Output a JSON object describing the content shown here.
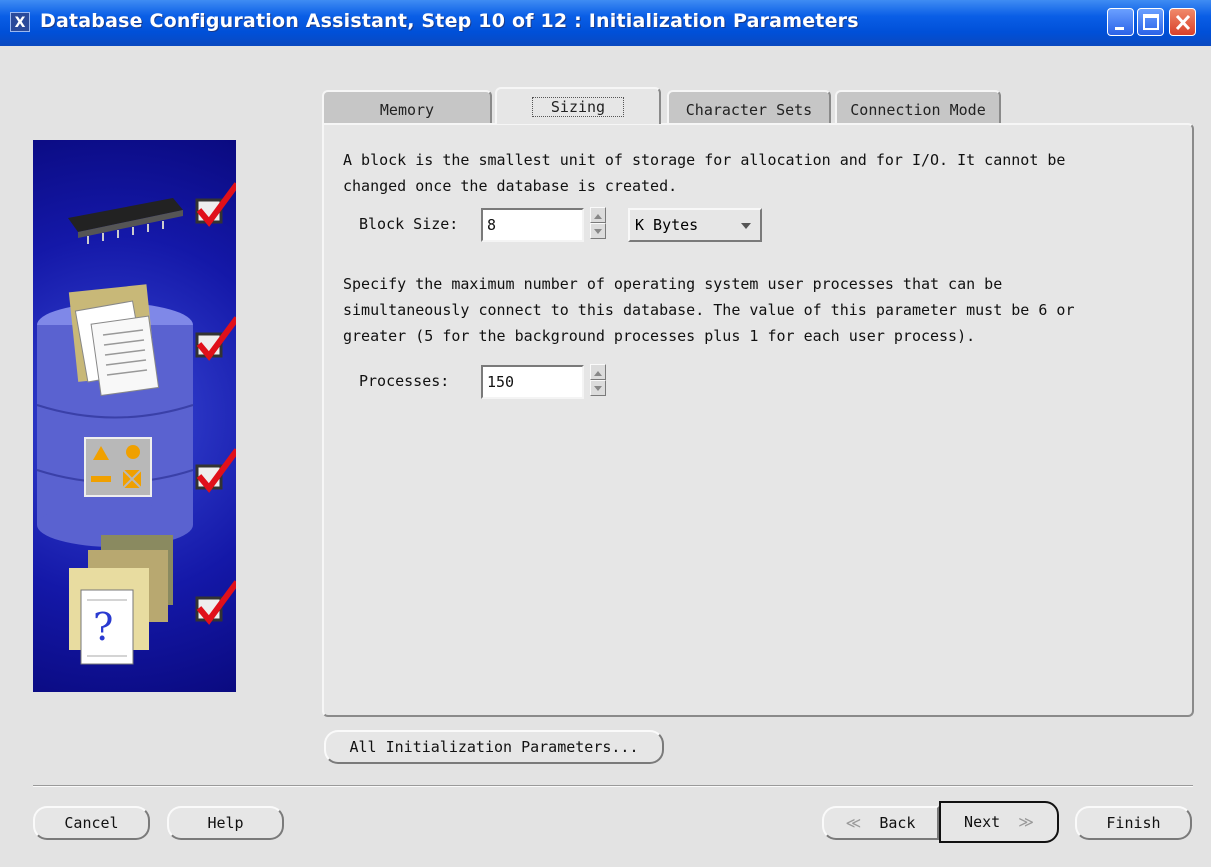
{
  "window": {
    "title": "Database Configuration Assistant, Step 10 of 12 : Initialization Parameters",
    "app_icon": "X",
    "controls": [
      "minimize-icon",
      "maximize-icon",
      "close-icon"
    ]
  },
  "sidebar": {
    "steps": [
      {
        "icon": "memory-chip-icon",
        "checked": true
      },
      {
        "icon": "documents-folder-icon",
        "checked": true
      },
      {
        "icon": "shapes-icon",
        "checked": true
      },
      {
        "icon": "help-document-icon",
        "checked": true
      }
    ]
  },
  "tabs": [
    {
      "label": "Memory",
      "active": false
    },
    {
      "label": "Sizing",
      "active": true
    },
    {
      "label": "Character Sets",
      "active": false
    },
    {
      "label": "Connection Mode",
      "active": false
    }
  ],
  "sizing": {
    "block_desc_line1": "A block is the smallest unit of storage for allocation and for I/O. It cannot be",
    "block_desc_line2": "changed once the database is created.",
    "block_size_label": "Block Size:",
    "block_size_value": "8",
    "block_unit": "K Bytes",
    "proc_desc_line1": "Specify the maximum number of operating system user processes that can be",
    "proc_desc_line2": "simultaneously connect to this database. The value of this parameter must be 6 or",
    "proc_desc_line3": "greater (5 for the background processes plus 1 for each user process).",
    "processes_label": "Processes:",
    "processes_value": "150"
  },
  "buttons": {
    "all_params": "All Initialization Parameters...",
    "cancel": "Cancel",
    "help": "Help",
    "back": "Back",
    "next": "Next",
    "finish": "Finish"
  },
  "colors": {
    "title_bar": "#0050d8",
    "side_panel": "#1418a8",
    "check": "#e0101a"
  }
}
